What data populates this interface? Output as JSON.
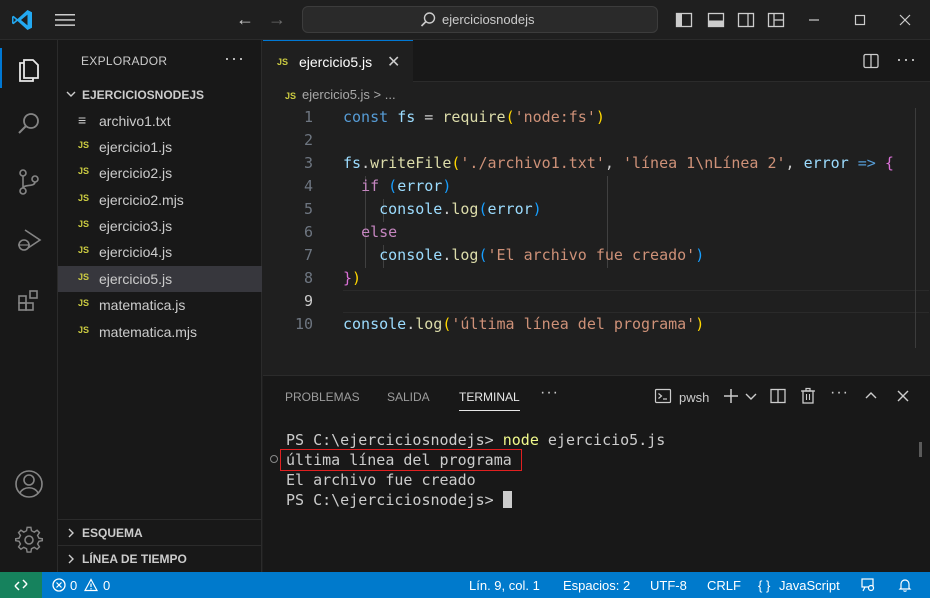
{
  "titlebar": {
    "search_text": "ejerciciosnodejs",
    "back_arrow": "←",
    "forward_arrow": "→"
  },
  "sidebar": {
    "header": "EXPLORADOR",
    "more": "···",
    "folder": "EJERCICIOSNODEJS",
    "files": [
      {
        "name": "archivo1.txt",
        "icon": "≡"
      },
      {
        "name": "ejercicio1.js",
        "icon": "JS"
      },
      {
        "name": "ejercicio2.js",
        "icon": "JS"
      },
      {
        "name": "ejercicio2.mjs",
        "icon": "JS"
      },
      {
        "name": "ejercicio3.js",
        "icon": "JS"
      },
      {
        "name": "ejercicio4.js",
        "icon": "JS"
      },
      {
        "name": "ejercicio5.js",
        "icon": "JS"
      },
      {
        "name": "matematica.js",
        "icon": "JS"
      },
      {
        "name": "matematica.mjs",
        "icon": "JS"
      }
    ],
    "outline": "ESQUEMA",
    "timeline": "LÍNEA DE TIEMPO"
  },
  "editor": {
    "tab_label": "ejercicio5.js",
    "tab_icon": "JS",
    "close_glyph": "✕",
    "breadcrumb": "ejercicio5.js > ...",
    "line_numbers": [
      "1",
      "2",
      "3",
      "4",
      "5",
      "6",
      "7",
      "8",
      "9",
      "10"
    ]
  },
  "panel": {
    "tabs": [
      "PROBLEMAS",
      "SALIDA",
      "TERMINAL"
    ],
    "more": "···",
    "shell": "pwsh",
    "terminal": {
      "prompt1": "PS C:\\ejerciciosnodejs> ",
      "cmd1": "node",
      "cmd1_args": " ejercicio5.js",
      "out1": "última línea del programa",
      "out2": "El archivo fue creado",
      "prompt2": "PS C:\\ejerciciosnodejs> "
    }
  },
  "statusbar": {
    "errors": "0",
    "warnings": "0",
    "position": "Lín. 9, col. 1",
    "spaces": "Espacios: 2",
    "encoding": "UTF-8",
    "eol": "CRLF",
    "language": "JavaScript",
    "language_glyph": "{ }"
  },
  "colors": {
    "accent": "#0078d4",
    "statusbar": "#007acc",
    "remote": "#16825d",
    "highlight_box": "#e02020"
  }
}
